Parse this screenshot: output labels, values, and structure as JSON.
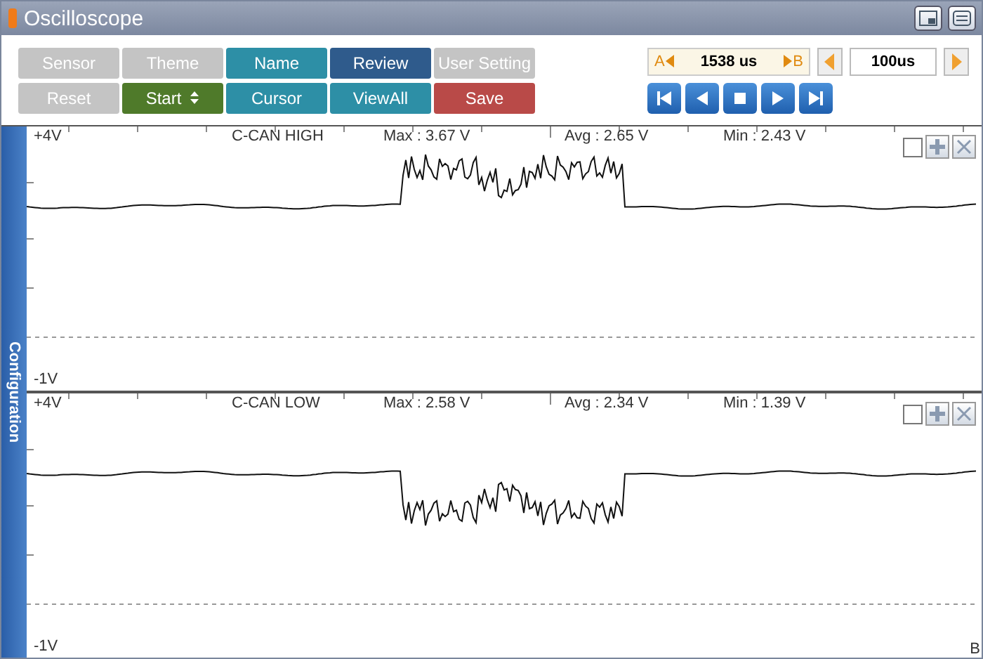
{
  "window": {
    "title": "Oscilloscope"
  },
  "buttons": [
    {
      "label": "Sensor",
      "kind": "grey"
    },
    {
      "label": "Theme",
      "kind": "grey"
    },
    {
      "label": "Name",
      "kind": "teal"
    },
    {
      "label": "Review",
      "kind": "navy"
    },
    {
      "label": "User Setting",
      "kind": "grey"
    },
    {
      "label": "Reset",
      "kind": "grey"
    },
    {
      "label": "Start",
      "kind": "green",
      "spinner": true
    },
    {
      "label": "Cursor",
      "kind": "teal"
    },
    {
      "label": "ViewAll",
      "kind": "teal"
    },
    {
      "label": "Save",
      "kind": "red"
    }
  ],
  "cursor": {
    "a_label": "A",
    "value": "1538 us",
    "b_label": "B"
  },
  "timebase": {
    "value": "100us"
  },
  "sidebar": {
    "label": "Configuration"
  },
  "channels": [
    {
      "top_label": "+4V",
      "name": "C-CAN HIGH",
      "max": "Max : 3.67 V",
      "avg": "Avg : 2.65 V",
      "min": "Min : 2.43 V",
      "bottom_label": "-1V",
      "kind": "up",
      "checked": false
    },
    {
      "top_label": "+4V",
      "name": "C-CAN LOW",
      "max": "Max : 2.58 V",
      "avg": "Avg : 2.34 V",
      "min": "Min : 1.39 V",
      "bottom_label": "-1V",
      "kind": "down",
      "checked": false,
      "corner_label": "B"
    }
  ]
}
